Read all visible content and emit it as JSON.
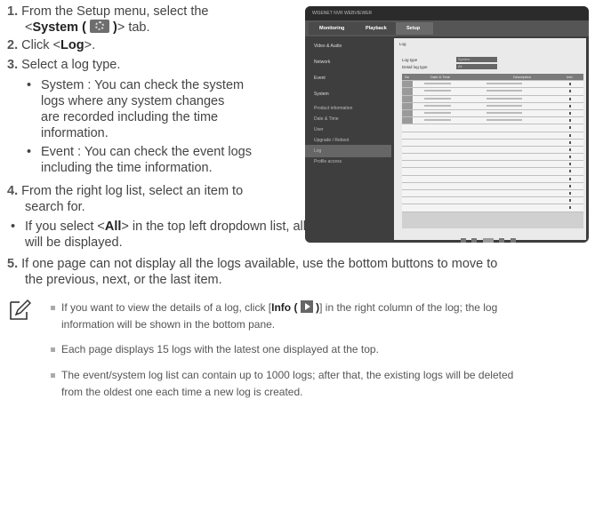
{
  "steps": [
    {
      "num": "1.",
      "pre": "From the Setup menu, select the",
      "line2_pre": "<",
      "bold": "System (",
      "bold2": ")",
      "line2_post": "> tab."
    },
    {
      "num": "2.",
      "pre": "Click <",
      "bold": "Log",
      "post": ">."
    },
    {
      "num": "3.",
      "text": "Select a log type."
    },
    {
      "num": "4.",
      "line1": "From the right log list, select an item to",
      "line2": "search for."
    },
    {
      "num": "5.",
      "line1": "If one page can not display all the logs available, use the bottom buttons to move to",
      "line2": "the previous, next, or the last item."
    }
  ],
  "bullets3": [
    {
      "bullet": "•",
      "lines": [
        "System : You can check the system",
        "logs where any system changes",
        "are recorded including the time",
        "information."
      ]
    },
    {
      "bullet": "•",
      "lines": [
        "Event : You can check the event logs",
        "including the time information."
      ]
    }
  ],
  "bullet4": {
    "bullet": "•",
    "pre": "If you select <",
    "bold": "All",
    "post": "> in the top left dropdown list, all logs for the applicable log type",
    "line2": "will be displayed."
  },
  "notes": [
    {
      "pre": "If you want to view the details of a log, click [",
      "bold": "Info (",
      "bold2": ")",
      "post": "] in the right column of the log; the log",
      "line2": "information will be shown in the bottom pane."
    },
    {
      "text": "Each page displays 15 logs with the latest one displayed at the top."
    },
    {
      "line1": "The event/system log list can contain up to 1000 logs; after that, the existing logs will be deleted",
      "line2": "from the oldest one each time a new log is created."
    }
  ],
  "note_icon": "note-pencil-icon",
  "icons": {
    "system_tab": "gear-icon",
    "info": "play-arrow-icon"
  },
  "screenshot": {
    "titlebar": "WISENET NVR WEBVIEWER",
    "tabs": [
      "Monitoring",
      "Playback",
      "Setup"
    ],
    "sidebar": [
      "Video & Audio",
      "Network",
      "Event",
      "System",
      "Product information",
      "Date & Time",
      "User",
      "Upgrade / Reboot",
      "Log",
      "Profile access"
    ],
    "main_title": "Log",
    "log_type_label": "Log type",
    "log_type_value": "System",
    "detail_label": "Detail log type",
    "detail_value": "All",
    "columns": [
      "No",
      "Date & Time",
      "Description",
      "Info"
    ]
  },
  "colors": {
    "text": "#444444",
    "bullet_square": "#aaaaaa",
    "screen_bg": "#3d3d3d"
  }
}
